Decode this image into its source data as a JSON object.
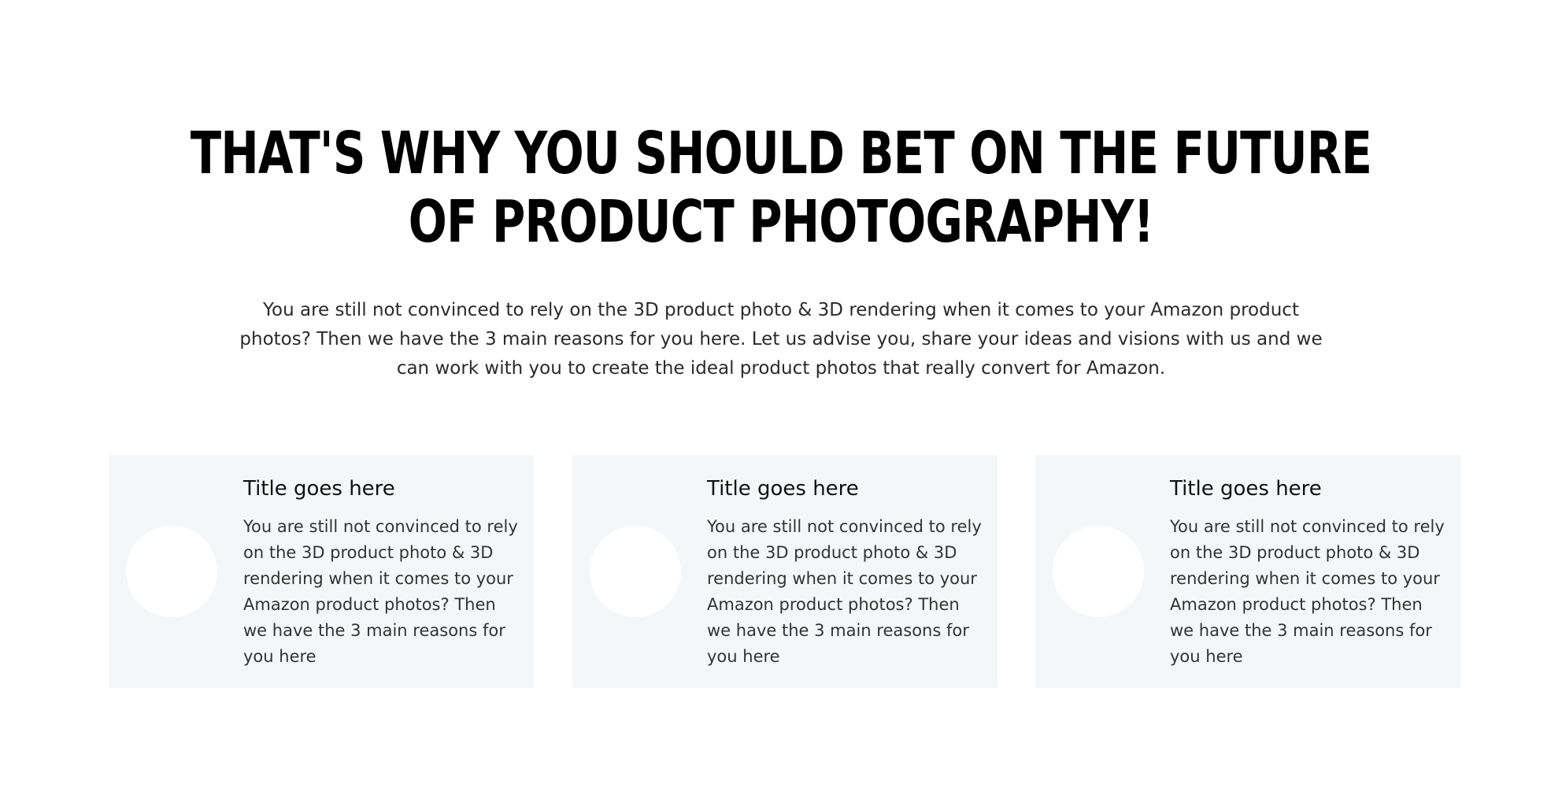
{
  "hero": {
    "headline_line1": "THAT'S WHY YOU SHOULD BET ON THE FUTURE",
    "headline_line2": "OF PRODUCT PHOTOGRAPHY!",
    "intro": "You are still not convinced to rely on the 3D product photo & 3D rendering when it comes to your Amazon product photos? Then we have the 3 main reasons for you here. Let us advise you, share your ideas and visions with us and we can work with you to create the ideal product photos that really convert for Amazon."
  },
  "cards": [
    {
      "title": "Title goes here",
      "text": "You are still not convinced to rely on the 3D product photo & 3D rendering when it comes to your Amazon product photos? Then we have the 3 main reasons for you here"
    },
    {
      "title": "Title goes here",
      "text": "You are still not convinced to rely on the 3D product photo & 3D rendering when it comes to your Amazon product photos? Then we have the 3 main reasons for you here"
    },
    {
      "title": "Title goes here",
      "text": "You are still not convinced to rely on the 3D product photo & 3D rendering when it comes to your Amazon product photos? Then we have the 3 main reasons for you here"
    }
  ],
  "colors": {
    "background": "#ffffff",
    "card_background": "#f5f6f7",
    "headline": "#000000",
    "body_text": "#2a2a2a"
  }
}
